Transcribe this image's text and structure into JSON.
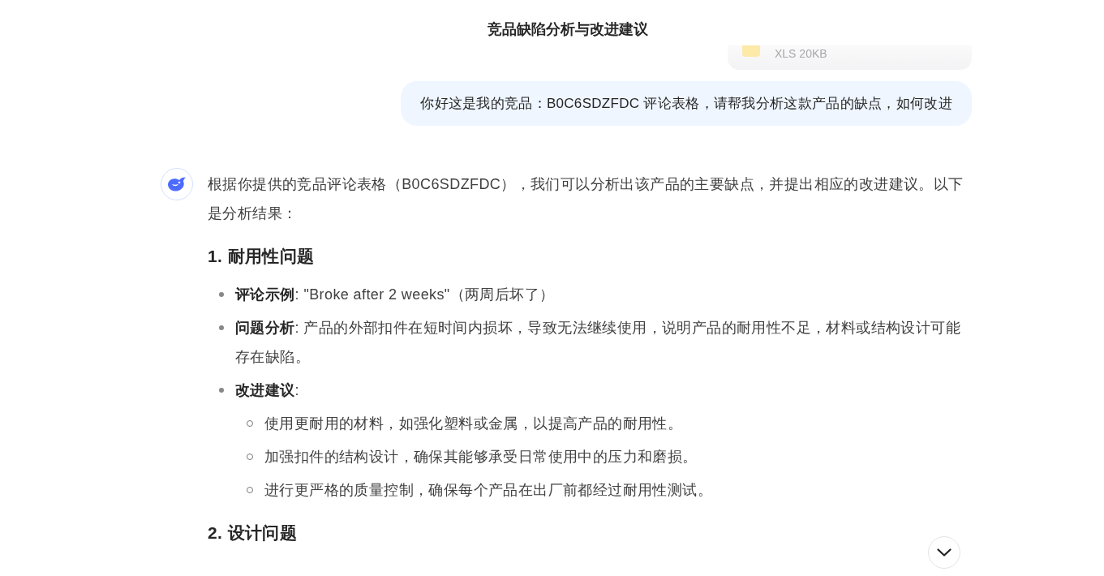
{
  "header": {
    "title": "竞品缺陷分析与改进建议"
  },
  "attachment": {
    "meta": "XLS 20KB"
  },
  "user_message": "你好这是我的竞品：B0C6SDZFDC 评论表格，请帮我分析这款产品的缺点，如何改进",
  "answer": {
    "intro": "根据你提供的竞品评论表格（B0C6SDZFDC），我们可以分析出该产品的主要缺点，并提出相应的改进建议。以下是分析结果：",
    "sections": [
      {
        "heading": "1. 耐用性问题",
        "items": [
          {
            "text": "**评论示例**: \"Broke after 2 weeks\"（两周后坏了）"
          },
          {
            "text": "**问题分析**: 产品的外部扣件在短时间内损坏，导致无法继续使用，说明产品的耐用性不足，材料或结构设计可能存在缺陷。"
          },
          {
            "text": "**改进建议**:",
            "children": [
              {
                "text": "使用更耐用的材料，如强化塑料或金属，以提高产品的耐用性。"
              },
              {
                "text": "加强扣件的结构设计，确保其能够承受日常使用中的压力和磨损。"
              },
              {
                "text": "进行更严格的质量控制，确保每个产品在出厂前都经过耐用性测试。"
              }
            ]
          }
        ]
      },
      {
        "heading": "2. 设计问题"
      }
    ]
  }
}
